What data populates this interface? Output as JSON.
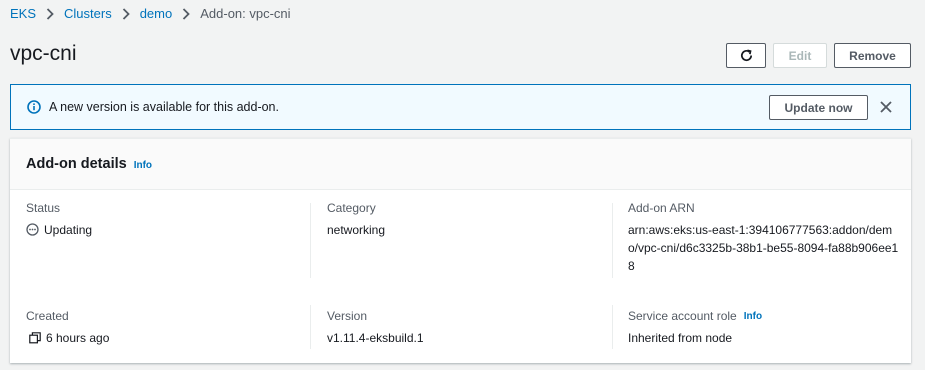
{
  "breadcrumb": {
    "items": [
      "EKS",
      "Clusters",
      "demo"
    ],
    "current": "Add-on: vpc-cni"
  },
  "page": {
    "title": "vpc-cni",
    "actions": {
      "edit": "Edit",
      "remove": "Remove"
    }
  },
  "flash": {
    "message": "A new version is available for this add-on.",
    "update_label": "Update now"
  },
  "details": {
    "title": "Add-on details",
    "info": "Info",
    "status": {
      "label": "Status",
      "value": "Updating"
    },
    "category": {
      "label": "Category",
      "value": "networking"
    },
    "arn": {
      "label": "Add-on ARN",
      "value": "arn:aws:eks:us-east-1:394106777563:addon/demo/vpc-cni/d6c3325b-38b1-be55-8094-fa88b906ee18"
    },
    "created": {
      "label": "Created",
      "value": "6 hours ago"
    },
    "version": {
      "label": "Version",
      "value": "v1.11.4-eksbuild.1"
    },
    "service_account": {
      "label": "Service account role",
      "info": "Info",
      "value": "Inherited from node"
    }
  },
  "colors": {
    "link": "#0073bb",
    "flash_bg": "#f1faff",
    "text": "#16191f",
    "muted": "#545b64"
  }
}
